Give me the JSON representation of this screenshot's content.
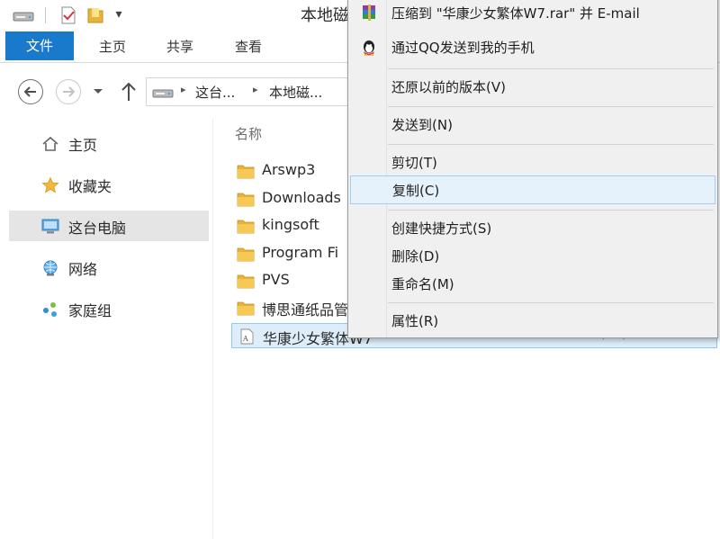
{
  "window": {
    "title": "本地磁"
  },
  "quick_access": {
    "dropdown_glyph": "▾"
  },
  "ribbon": {
    "tabs": [
      {
        "label": "文件"
      },
      {
        "label": "主页"
      },
      {
        "label": "共享"
      },
      {
        "label": "查看"
      }
    ]
  },
  "address": {
    "crumbs": [
      "这台...",
      "本地磁..."
    ],
    "separator": "▸"
  },
  "nav_pane": {
    "items": [
      {
        "label": "主页",
        "icon": "home-icon"
      },
      {
        "label": "收藏夹",
        "icon": "star-icon"
      },
      {
        "label": "这台电脑",
        "icon": "computer-icon",
        "selected": true
      },
      {
        "label": "网络",
        "icon": "network-icon"
      },
      {
        "label": "家庭组",
        "icon": "homegroup-icon"
      }
    ]
  },
  "content": {
    "column_name": "名称",
    "files": [
      {
        "name": "Arswp3",
        "icon": "folder-icon"
      },
      {
        "name": "Downloads",
        "icon": "folder-icon"
      },
      {
        "name": "kingsoft",
        "icon": "folder-icon"
      },
      {
        "name": "Program Fi",
        "icon": "folder-icon"
      },
      {
        "name": "PVS",
        "icon": "folder-icon"
      },
      {
        "name": "博思通纸品管",
        "icon": "folder-icon"
      },
      {
        "name": "华康少女繁体W7",
        "icon": "font-file-icon",
        "date": "2015/10/29 10:3",
        "selected": true
      }
    ]
  },
  "context_menu": {
    "items": [
      {
        "label": "压缩到 \"华康少女繁体W7.rar\" 并 E-mail",
        "icon": "winrar-icon"
      },
      {
        "label": "通过QQ发送到我的手机",
        "icon": "qq-icon"
      },
      {
        "label": "还原以前的版本(V)"
      },
      {
        "label": "发送到(N)"
      },
      {
        "label": "剪切(T)"
      },
      {
        "label": "复制(C)",
        "highlighted": true
      },
      {
        "label": "创建快捷方式(S)"
      },
      {
        "label": "删除(D)"
      },
      {
        "label": "重命名(M)"
      },
      {
        "label": "属性(R)"
      }
    ]
  },
  "colors": {
    "file_tab": "#1979ca",
    "folder": "#e8b33a",
    "selection": "#ddeefa",
    "menu_highlight": "#e5f1fb"
  }
}
